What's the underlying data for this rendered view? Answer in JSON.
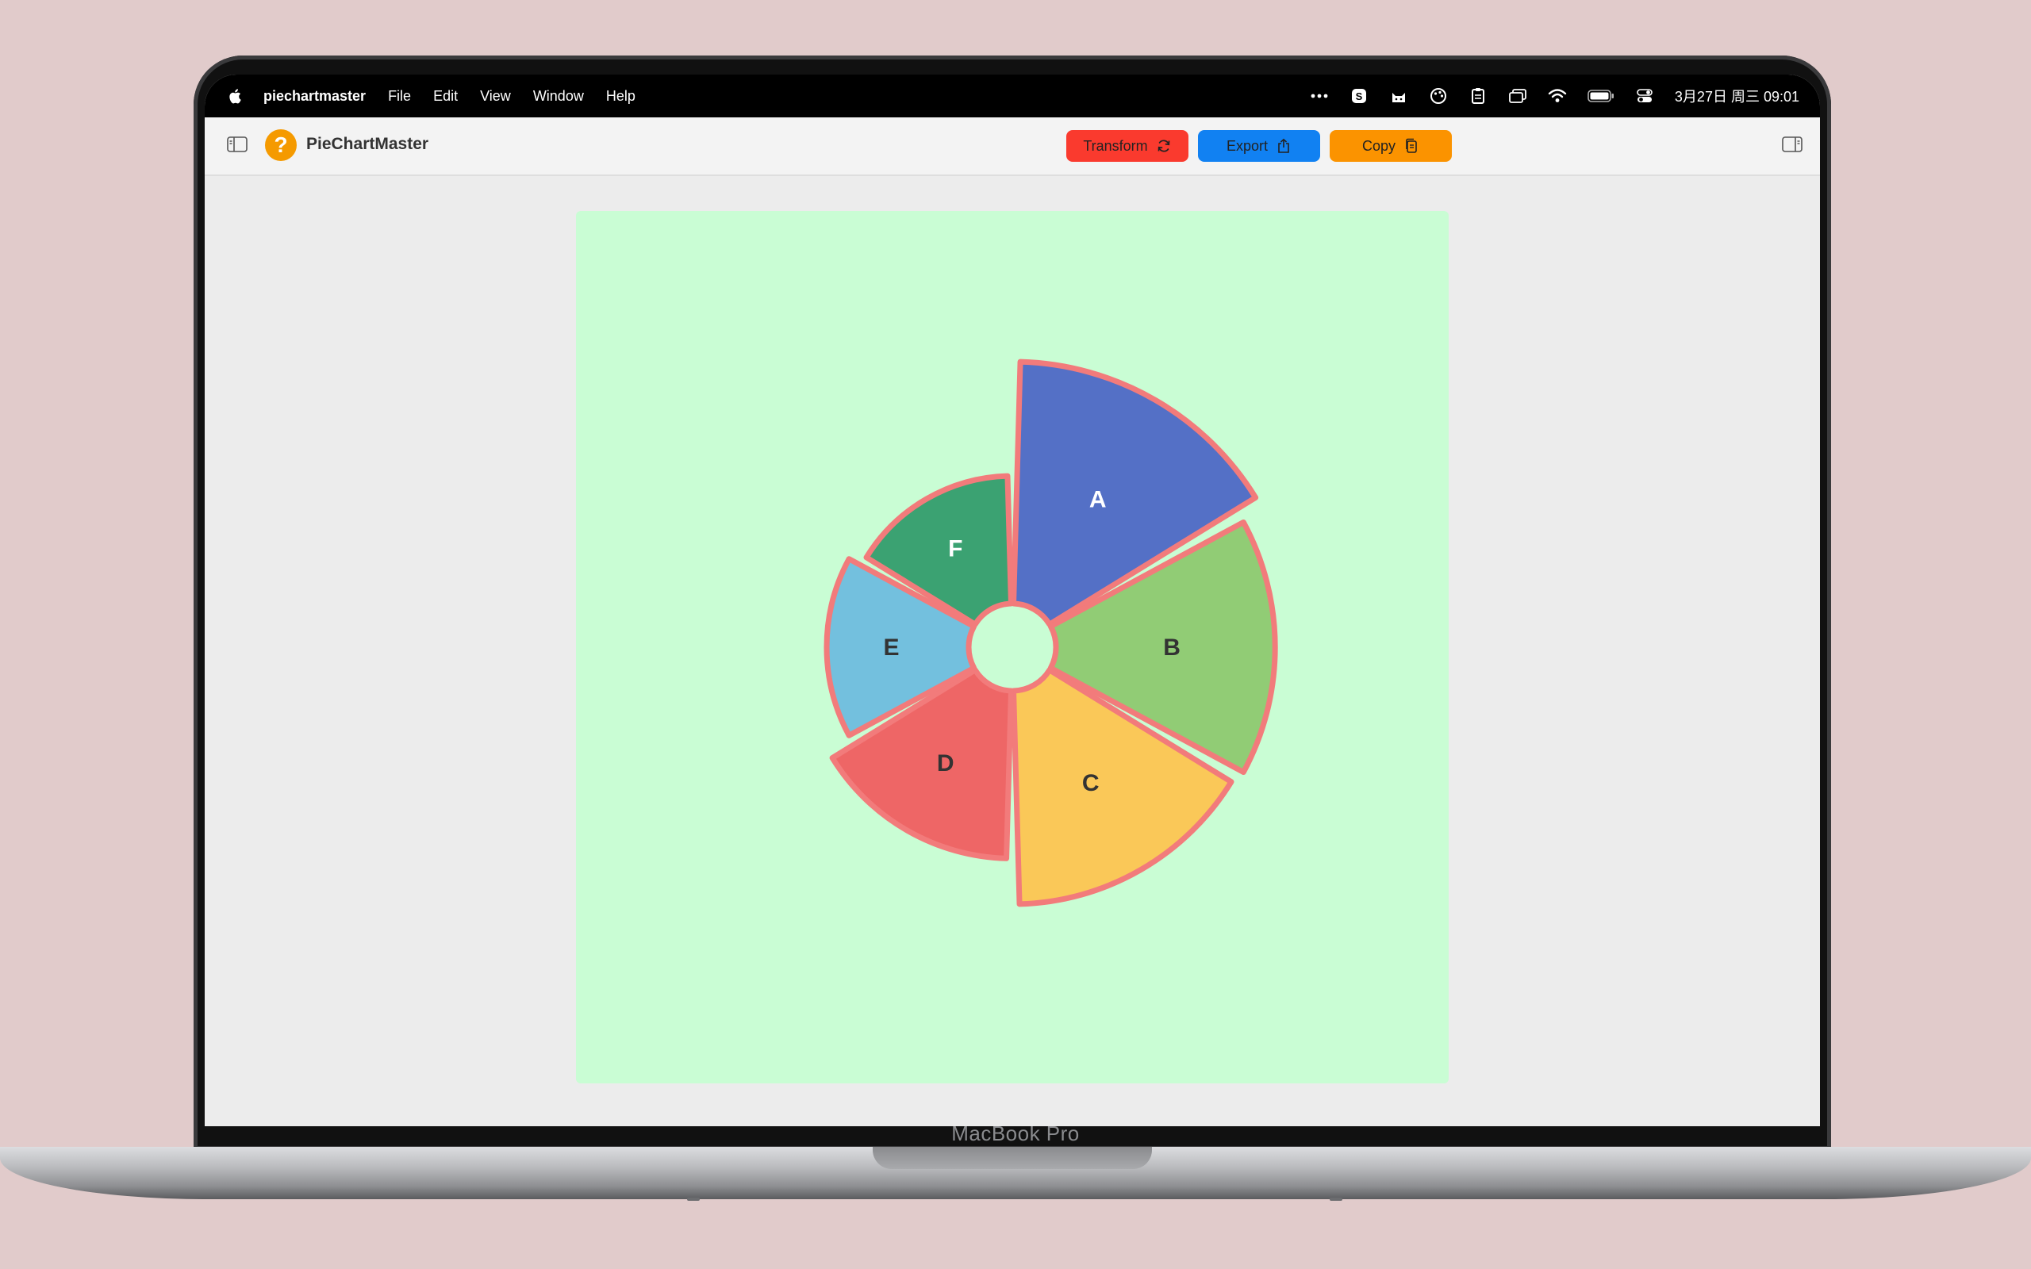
{
  "device": {
    "brand_label": "MacBook Pro"
  },
  "menubar": {
    "app_name": "piechartmaster",
    "menus": [
      "File",
      "Edit",
      "View",
      "Window",
      "Help"
    ],
    "clock": "3月27日 周三  09:01"
  },
  "toolbar": {
    "app_title": "PieChartMaster",
    "logo_glyph": "?",
    "transform_label": "Transform",
    "export_label": "Export",
    "copy_label": "Copy"
  },
  "colors": {
    "transform": "#fa3a2e",
    "export": "#1181f2",
    "copy": "#fb9300",
    "canvas_bg": "#c9fdd4",
    "slice_stroke": "#f27b7b"
  },
  "chart_data": {
    "type": "pie",
    "variant": "donut-rounded",
    "labels": [
      "A",
      "B",
      "C",
      "D",
      "E",
      "F"
    ],
    "values": [
      1,
      1,
      1,
      1,
      1,
      1
    ],
    "radial_extent": [
      1.0,
      0.92,
      0.9,
      0.74,
      0.65,
      0.6
    ],
    "colors": [
      "#5470c6",
      "#91cc75",
      "#fac858",
      "#ee6666",
      "#73c0de",
      "#3ba272"
    ],
    "label_colors": [
      "#ffffff",
      "#333333",
      "#333333",
      "#333333",
      "#333333",
      "#ffffff"
    ]
  }
}
